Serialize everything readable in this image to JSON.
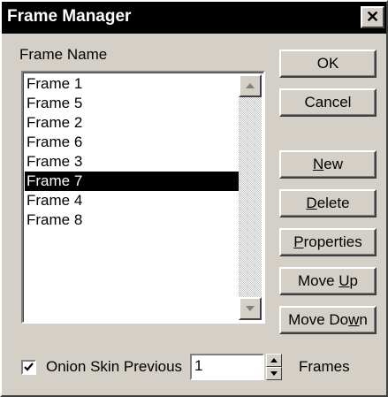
{
  "window": {
    "title": "Frame Manager",
    "close_glyph": "✕"
  },
  "frame_list": {
    "label": "Frame Name",
    "items": [
      "Frame 1",
      "Frame 5",
      "Frame 2",
      "Frame 6",
      "Frame 3",
      "Frame 7",
      "Frame 4",
      "Frame 8"
    ],
    "selected_index": 5
  },
  "buttons": {
    "ok": "OK",
    "cancel": "Cancel",
    "new": {
      "mnemonic": "N",
      "rest": "ew"
    },
    "delete": {
      "mnemonic": "D",
      "rest": "elete"
    },
    "properties": {
      "mnemonic": "P",
      "rest": "roperties"
    },
    "move_up": {
      "before": "Move ",
      "mnemonic": "U",
      "rest": "p"
    },
    "move_down": {
      "before": "Move Do",
      "mnemonic": "w",
      "rest": "n"
    }
  },
  "onion_skin": {
    "checked": true,
    "label": "Onion Skin Previous",
    "value": "1",
    "suffix": "Frames"
  },
  "icons": {
    "close": "close-icon",
    "scroll_up": "arrow-up-icon",
    "scroll_down": "arrow-down-icon",
    "spin_up": "spin-up-icon",
    "spin_down": "spin-down-icon",
    "check": "checkmark-icon"
  }
}
